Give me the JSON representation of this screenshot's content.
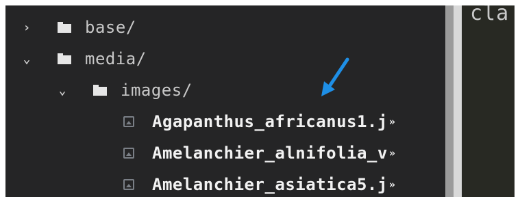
{
  "tree": {
    "items": [
      {
        "label": "base/",
        "expanded": false,
        "chevron": "›"
      },
      {
        "label": "media/",
        "expanded": true,
        "chevron": "⌄"
      },
      {
        "label": "images/",
        "expanded": true,
        "chevron": "⌄"
      }
    ],
    "files": [
      {
        "label": "Agapanthus_africanus1.j",
        "overflow": "»"
      },
      {
        "label": "Amelanchier_alnifolia_v",
        "overflow": "»"
      },
      {
        "label": "Amelanchier_asiatica5.j",
        "overflow": "»"
      }
    ]
  },
  "editor": {
    "visible_code": "cla"
  },
  "colors": {
    "sidebar_bg": "#252526",
    "editor_bg": "#282923",
    "annotation_arrow": "#1e8fe6"
  },
  "icons": {
    "folder": "folder-icon",
    "file": "image-file-icon",
    "annotation": "blue-pointer-arrow"
  }
}
